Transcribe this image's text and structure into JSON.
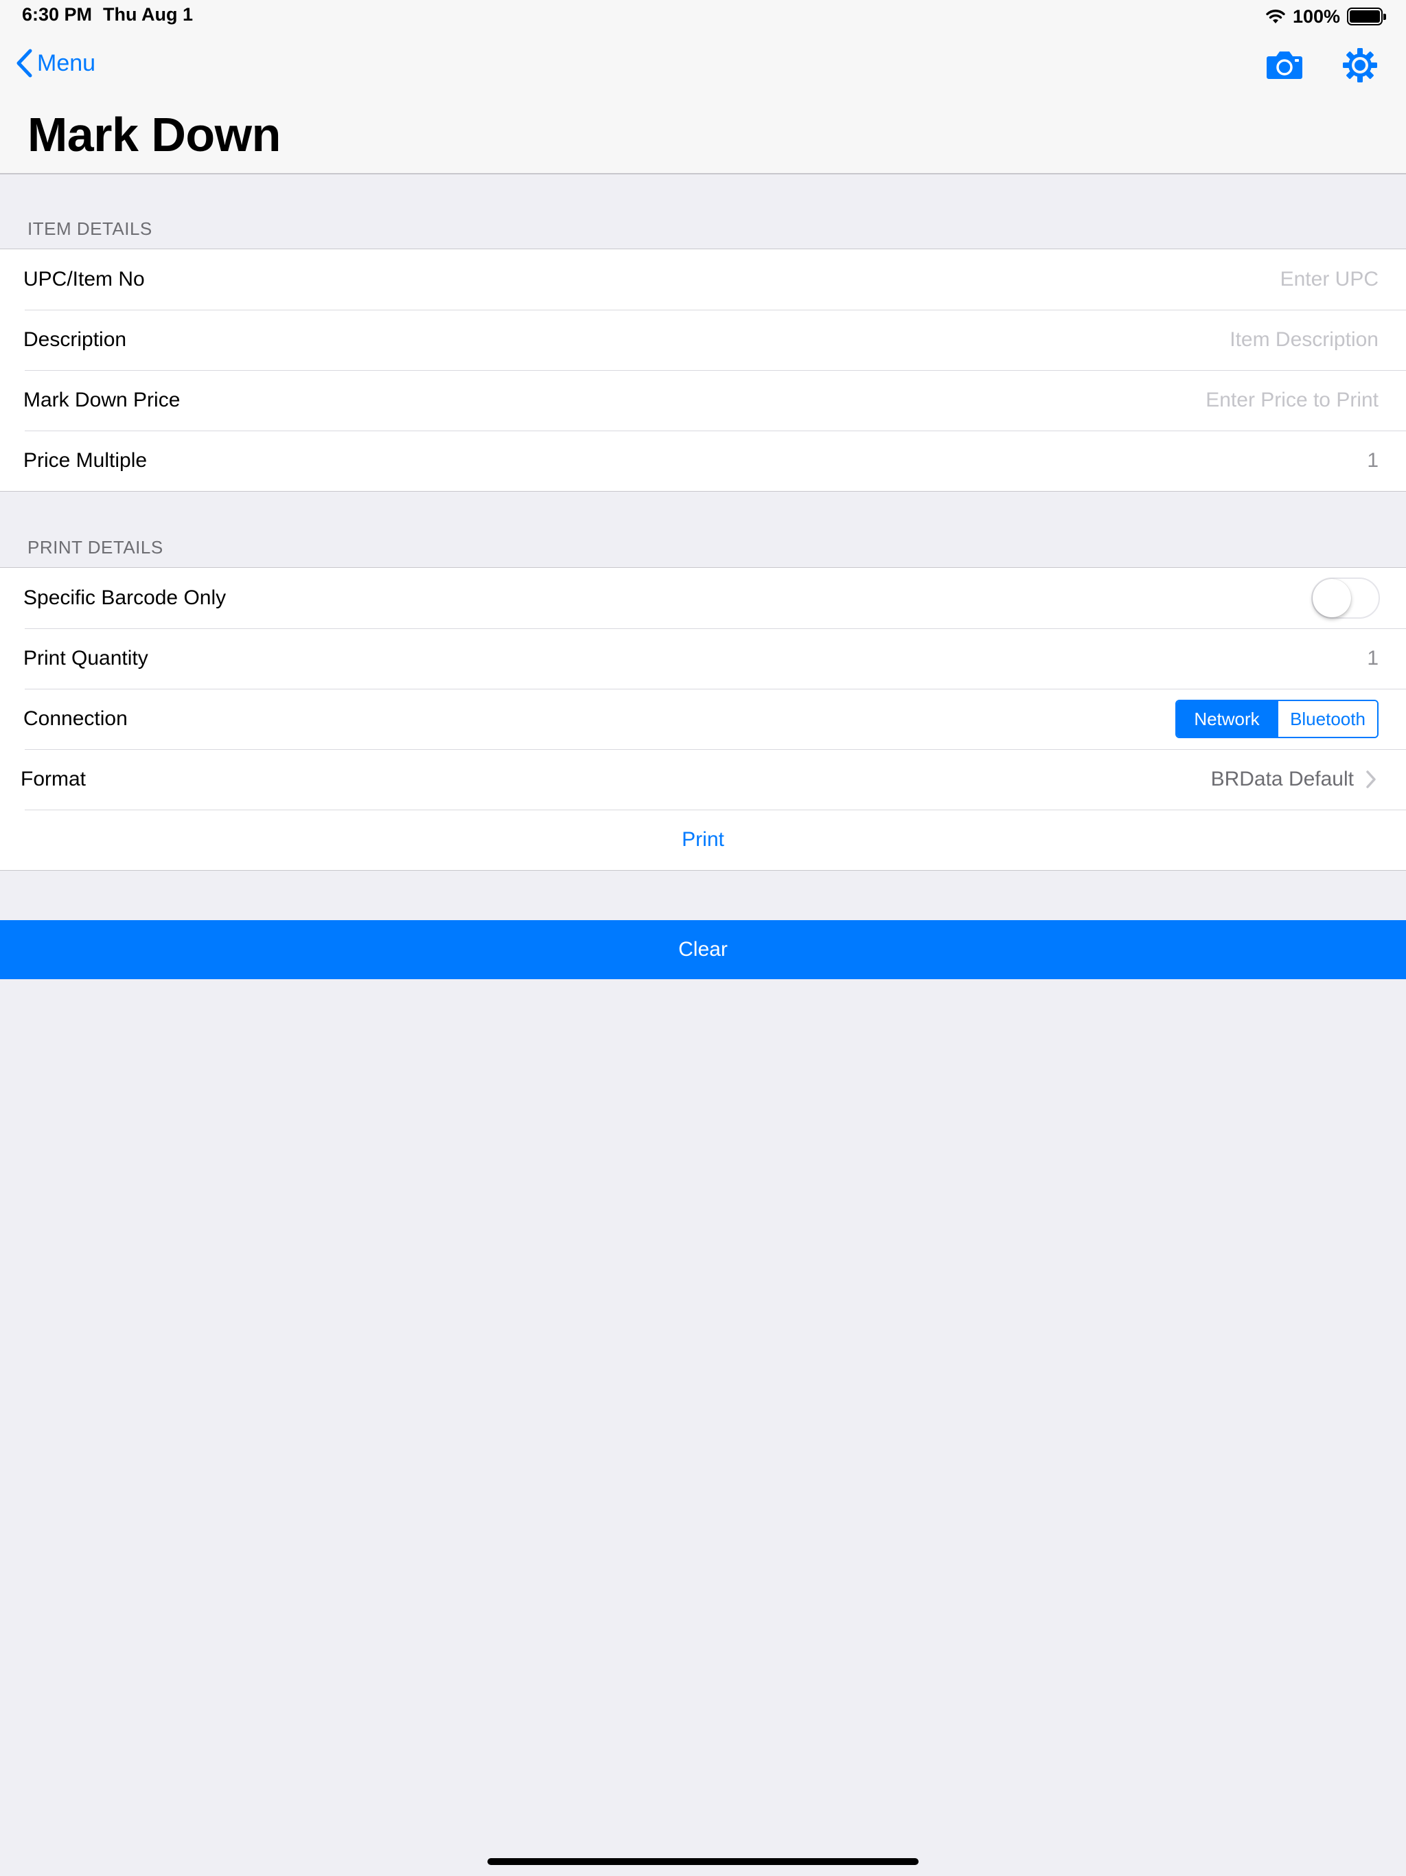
{
  "status": {
    "time": "6:30 PM",
    "date": "Thu Aug 1",
    "battery": "100%",
    "battery_level": 1.0
  },
  "nav": {
    "back_label": "Menu",
    "title": "Mark Down",
    "icons": [
      "chevron-left-icon",
      "camera-icon",
      "gear-icon"
    ]
  },
  "item_details": {
    "header": "ITEM DETAILS",
    "rows": [
      {
        "label": "UPC/Item No",
        "placeholder": "Enter UPC",
        "value": ""
      },
      {
        "label": "Description",
        "placeholder": "Item Description",
        "value": ""
      },
      {
        "label": "Mark Down Price",
        "placeholder": "Enter Price to Print",
        "value": ""
      },
      {
        "label": "Price Multiple",
        "placeholder": "",
        "value": "1"
      }
    ]
  },
  "print_details": {
    "header": "PRINT DETAILS",
    "specific_barcode": {
      "label": "Specific Barcode Only",
      "on": false
    },
    "print_quantity": {
      "label": "Print Quantity",
      "value": "1"
    },
    "connection": {
      "label": "Connection",
      "options": [
        "Network",
        "Bluetooth"
      ],
      "selected": "Network"
    },
    "format": {
      "label": "Format",
      "value": "BRData Default"
    },
    "print_label": "Print"
  },
  "clear_label": "Clear",
  "colors": {
    "accent": "#007aff",
    "background": "#efeff4",
    "placeholder": "#c4c4c9"
  }
}
